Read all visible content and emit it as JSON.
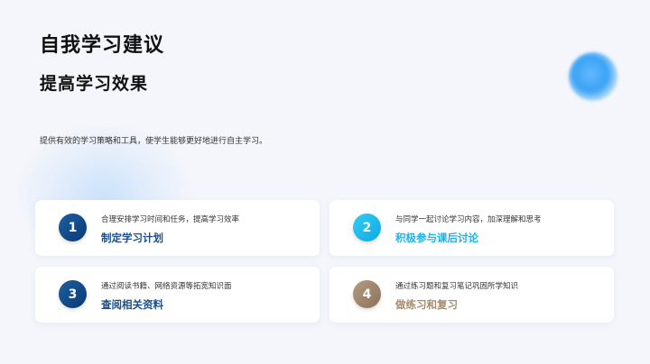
{
  "header": {
    "title": "自我学习建议",
    "subtitle": "提高学习效果",
    "description": "提供有效的学习策略和工具，使学生能够更好地进行自主学习。"
  },
  "cards": [
    {
      "number": "1",
      "description": "合理安排学习时间和任务，提高学习效率",
      "title": "制定学习计划",
      "color": "#1b4f8a"
    },
    {
      "number": "2",
      "description": "与同学一起讨论学习内容，加深理解和思考",
      "title": "积极参与课后讨论",
      "color": "#18b3e8"
    },
    {
      "number": "3",
      "description": "通过阅读书籍、网络资源等拓宽知识面",
      "title": "查阅相关资料",
      "color": "#1b4f8a"
    },
    {
      "number": "4",
      "description": "通过练习题和复习笔记巩固所学知识",
      "title": "做练习和复习",
      "color": "#a88b6e"
    }
  ]
}
